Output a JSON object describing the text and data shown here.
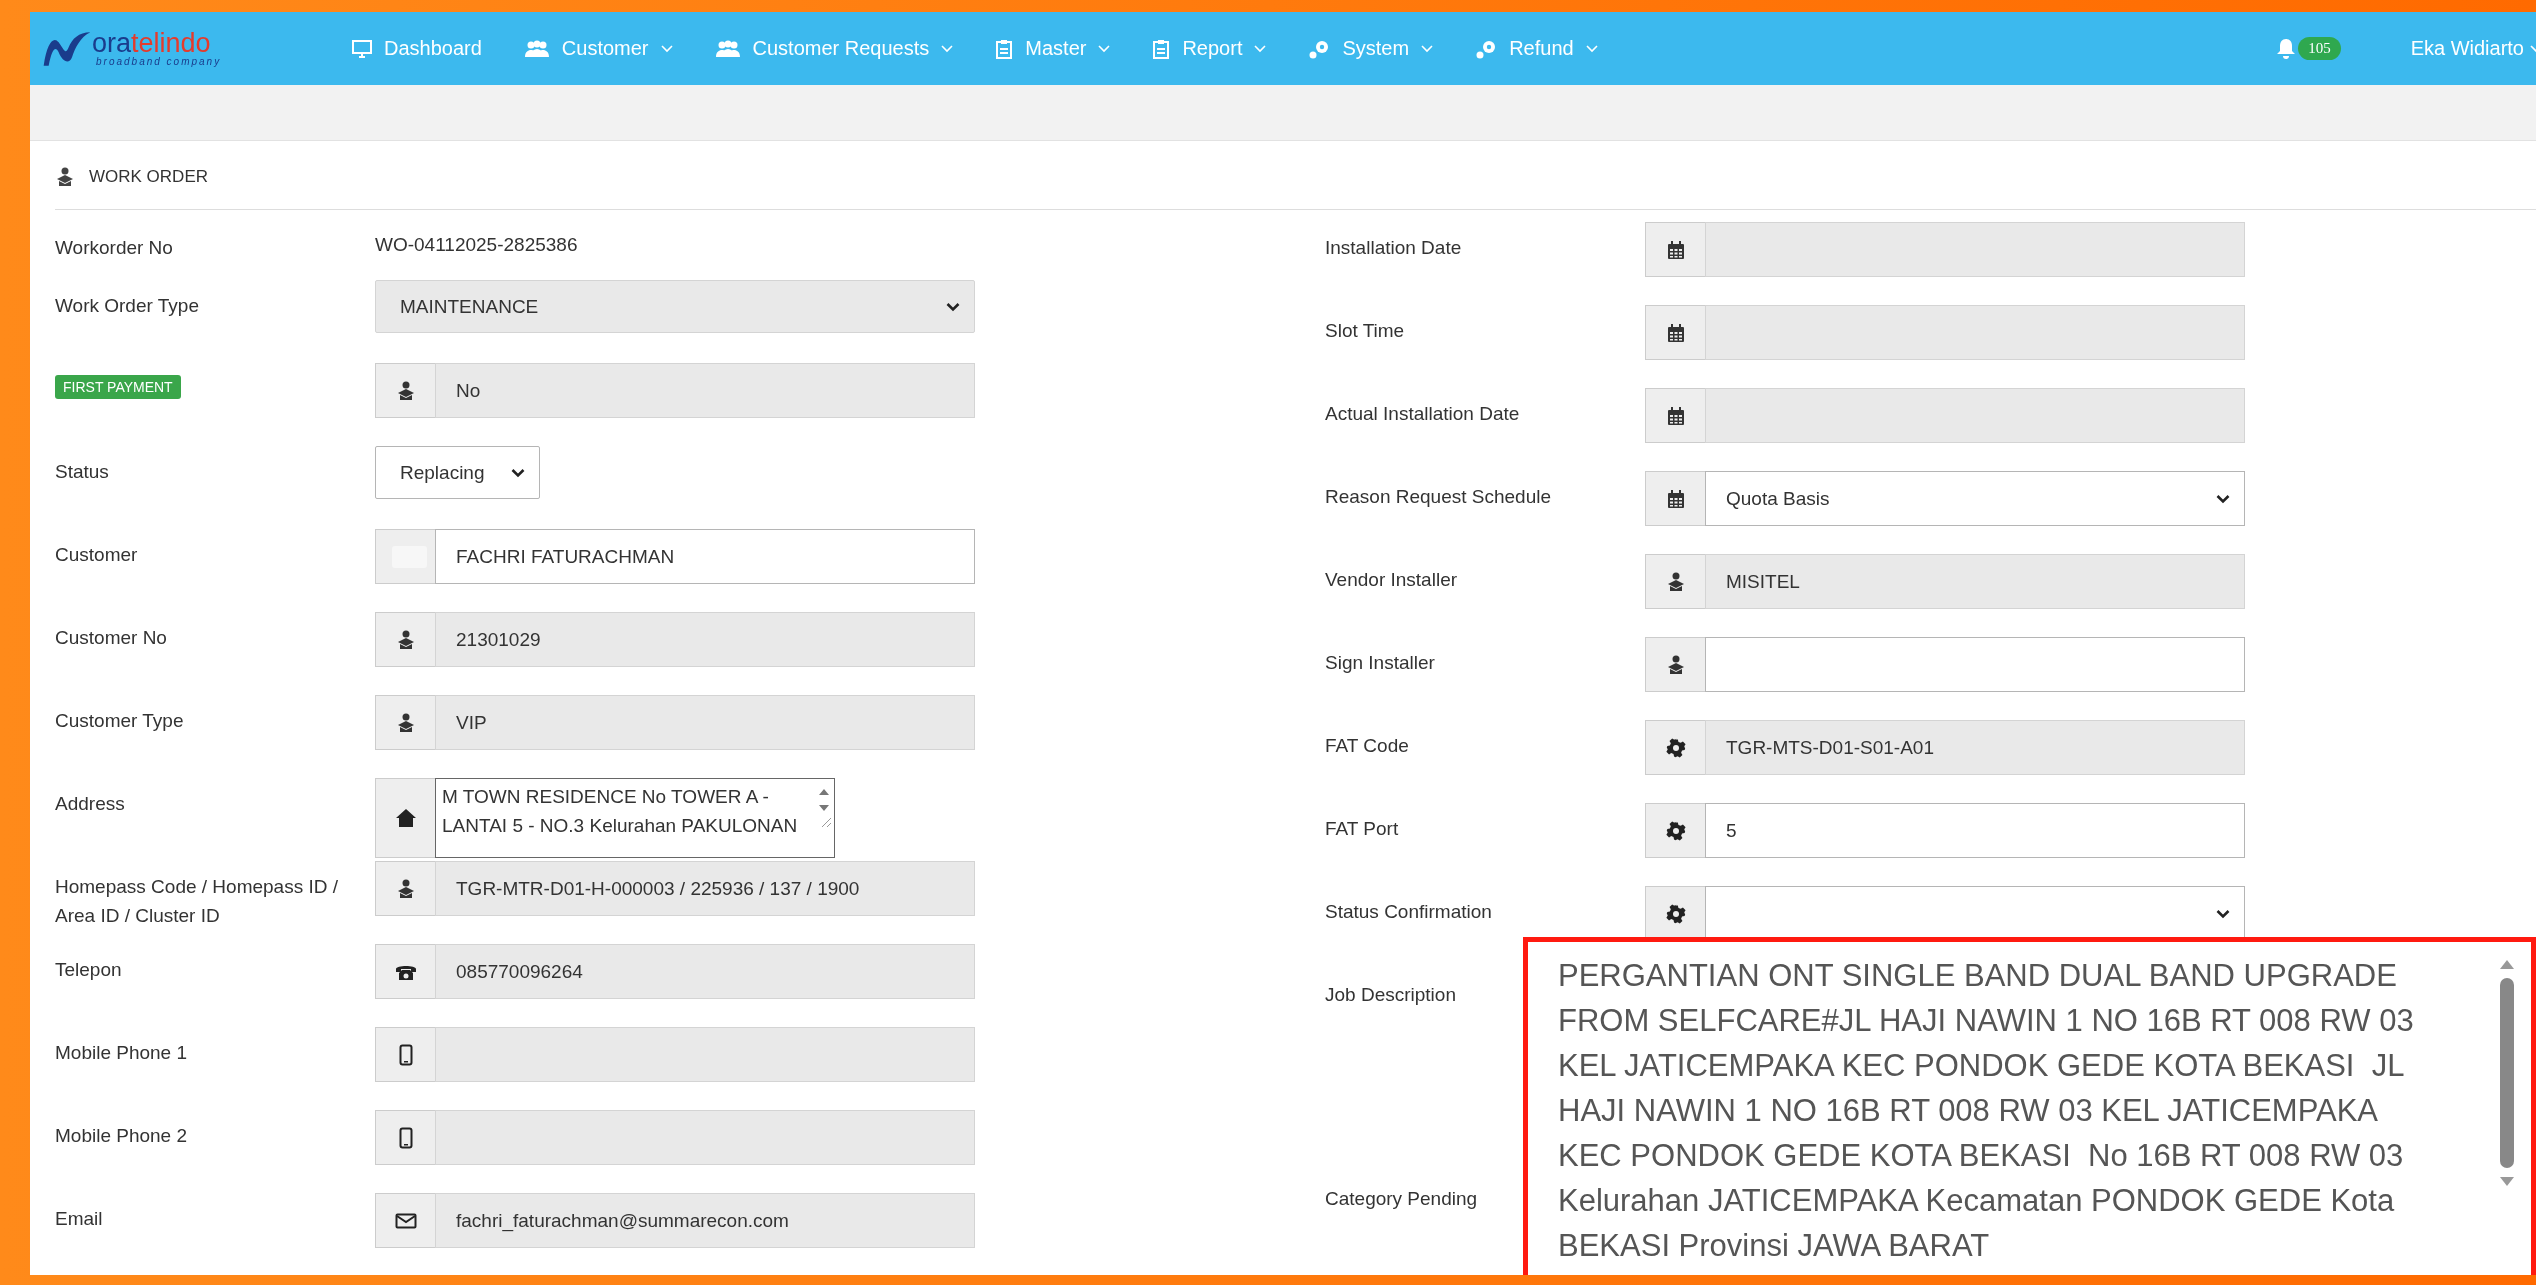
{
  "nav": {
    "brand": {
      "prefix": "ora",
      "suffix": "telindo",
      "tagline": "broadband company"
    },
    "items": [
      {
        "label": "Dashboard",
        "kind": "monitor",
        "dropdown": false
      },
      {
        "label": "Customer",
        "kind": "people",
        "dropdown": true
      },
      {
        "label": "Customer Requests",
        "kind": "people",
        "dropdown": true
      },
      {
        "label": "Master",
        "kind": "clipboard",
        "dropdown": true
      },
      {
        "label": "Report",
        "kind": "clipboard",
        "dropdown": true
      },
      {
        "label": "System",
        "kind": "gears",
        "dropdown": true
      },
      {
        "label": "Refund",
        "kind": "gears",
        "dropdown": true
      }
    ],
    "notifications": "105",
    "user": "Eka Widiarto"
  },
  "page": {
    "title": "WORK ORDER"
  },
  "left_fields": [
    {
      "label": "Workorder No",
      "kind": "plain",
      "value": "WO-04112025-2825386"
    },
    {
      "label": "Work Order Type",
      "kind": "select",
      "value": "MAINTENANCE",
      "readonly": true
    },
    {
      "label": "FIRST PAYMENT",
      "label_badge": true,
      "kind": "person",
      "value": "No",
      "readonly": true
    },
    {
      "label": "Status",
      "kind": "select_small",
      "value": "Replacing",
      "readonly": false
    },
    {
      "label": "Customer",
      "kind": "customer",
      "value": "FACHRI FATURACHMAN",
      "readonly": false
    },
    {
      "label": "Customer No",
      "kind": "person",
      "value": "21301029",
      "readonly": true
    },
    {
      "label": "Customer Type",
      "kind": "person",
      "value": "VIP",
      "readonly": true
    },
    {
      "label": "Address",
      "kind": "address",
      "value": "M TOWN RESIDENCE No TOWER A - LANTAI 5 - NO.3 Kelurahan PAKULONAN",
      "readonly": false
    },
    {
      "label": "Homepass Code / Homepass ID / Area ID / Cluster ID",
      "kind": "person",
      "value": "TGR-MTR-D01-H-000003 / 225936 / 137 / 1900",
      "readonly": true
    },
    {
      "label": "Telepon",
      "kind": "phone",
      "value": "085770096264",
      "readonly": true
    },
    {
      "label": "Mobile Phone 1",
      "kind": "mobile",
      "readonly": true
    },
    {
      "label": "Mobile Phone 2",
      "kind": "mobile",
      "readonly": true
    },
    {
      "label": "Email",
      "kind": "email",
      "value": "fachri_faturachman@summarecon.com",
      "readonly": true
    }
  ],
  "right_fields": [
    {
      "label": "Installation Date",
      "kind": "date",
      "readonly": true
    },
    {
      "label": "Slot Time",
      "kind": "date",
      "readonly": true
    },
    {
      "label": "Actual Installation Date",
      "kind": "date",
      "readonly": true
    },
    {
      "label": "Reason Request Schedule",
      "kind": "date",
      "select": true,
      "value": "Quota Basis",
      "readonly": false
    },
    {
      "label": "Vendor Installer",
      "kind": "person",
      "value": "MISITEL",
      "readonly": true
    },
    {
      "label": "Sign Installer",
      "kind": "person",
      "readonly": false
    },
    {
      "label": "FAT Code",
      "kind": "gear",
      "value": "TGR-MTS-D01-S01-A01",
      "readonly": true
    },
    {
      "label": "FAT Port",
      "kind": "gear",
      "value": "5",
      "readonly": false
    },
    {
      "label": "Status Confirmation",
      "kind": "gear",
      "select": true,
      "readonly": false
    },
    {
      "label": "Job Description",
      "kind": "hidden"
    },
    {
      "label": "Category Pending",
      "kind": "hidden"
    }
  ],
  "callout": {
    "text": "PERGANTIAN ONT SINGLE BAND DUAL BAND UPGRADE FROM SELFCARE#JL HAJI NAWIN 1 NO 16B RT 008 RW 03 KEL JATICEMPAKA KEC PONDOK GEDE KOTA BEKASI  JL HAJI NAWIN 1 NO 16B RT 008 RW 03 KEL JATICEMPAKA KEC PONDOK GEDE KOTA BEKASI  No 16B RT 008 RW 03 Kelurahan JATICEMPAKA Kecamatan PONDOK GEDE Kota BEKASI Provinsi JAWA BARAT"
  }
}
